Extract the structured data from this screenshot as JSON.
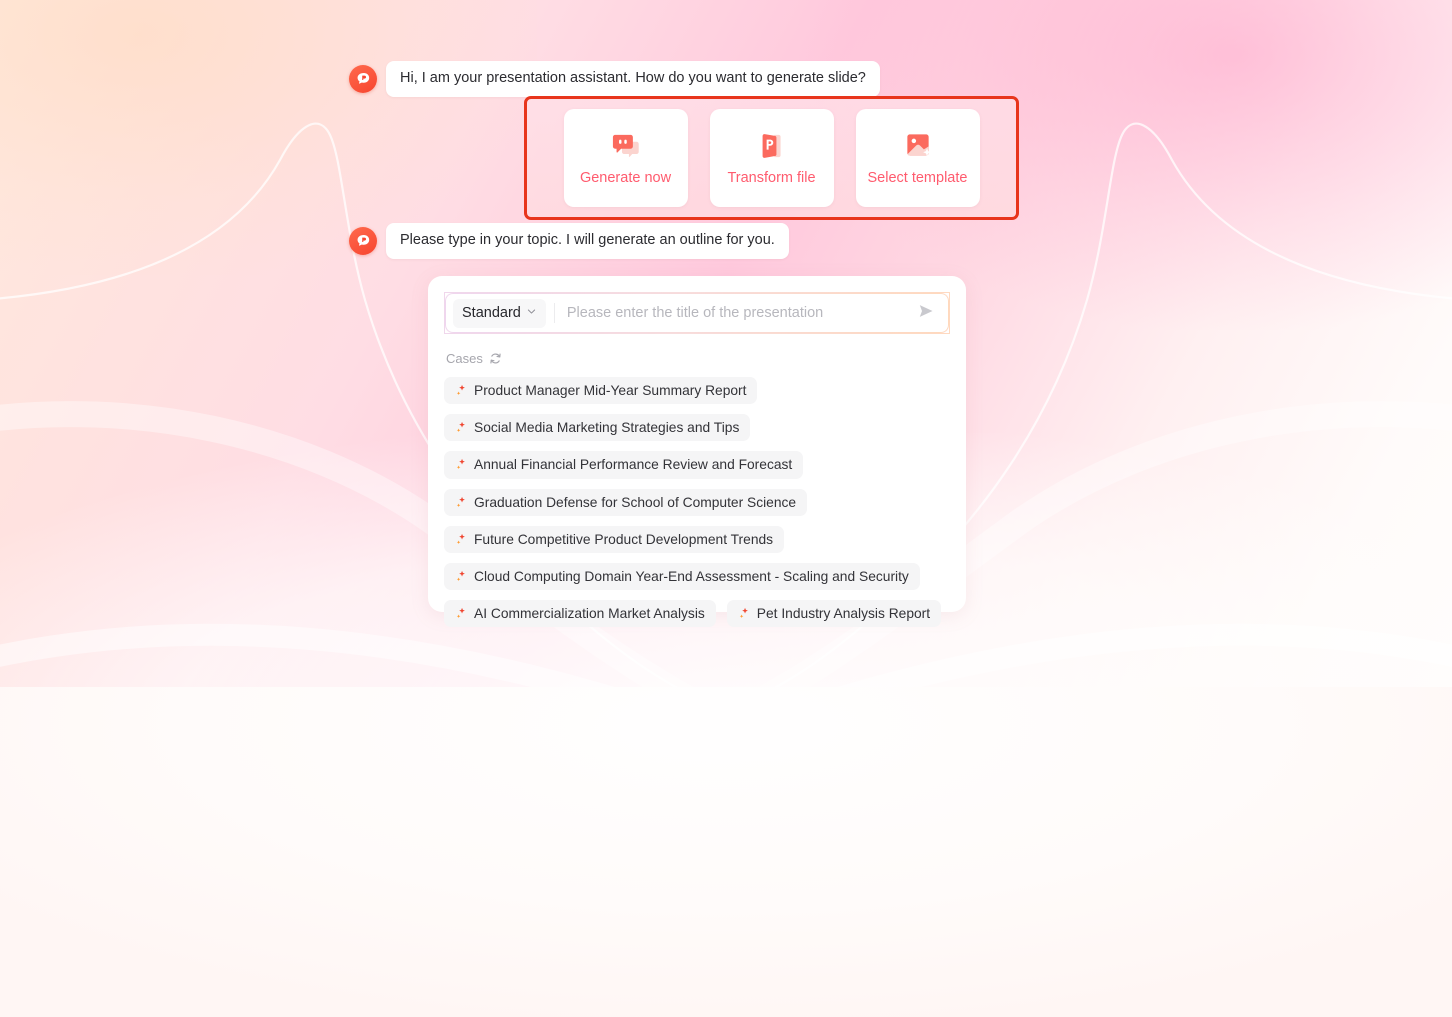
{
  "theme": {
    "accent": "#ff5b6e",
    "avatar_bg": "#f7452f",
    "highlight_border": "#e8351c",
    "panel_bg": "#ffffff",
    "chip_bg": "#f5f5f6",
    "background_gradient": [
      "#ffe9dd",
      "#ffc9dd",
      "#fffdfc"
    ]
  },
  "messages": [
    {
      "avatar_icon": "assistant-chat-bubble-icon",
      "text": "Hi, I am your presentation assistant. How do you want to generate slide?"
    },
    {
      "avatar_icon": "assistant-chat-bubble-icon",
      "text": "Please type in your topic. I will generate an outline for you."
    }
  ],
  "action_panel": {
    "cards": [
      {
        "label": "Generate now",
        "icon": "chat-bubble-icon"
      },
      {
        "label": "Transform file",
        "icon": "powerpoint-file-icon"
      },
      {
        "label": "Select template",
        "icon": "image-sparkle-icon"
      }
    ]
  },
  "composer": {
    "mode": {
      "label": "Standard",
      "chevron_icon": "chevron-down-icon"
    },
    "input": {
      "value": "",
      "placeholder": "Please enter the title of the presentation"
    },
    "send": {
      "icon": "send-arrow-icon"
    },
    "cases": {
      "label": "Cases",
      "refresh_icon": "refresh-icon",
      "items": [
        {
          "label": "Product Manager Mid-Year Summary Report",
          "icon": "sparkle-icon"
        },
        {
          "label": "Social Media Marketing Strategies and Tips",
          "icon": "sparkle-icon"
        },
        {
          "label": "Annual Financial Performance Review and Forecast",
          "icon": "sparkle-icon"
        },
        {
          "label": "Graduation Defense for School of Computer Science",
          "icon": "sparkle-icon"
        },
        {
          "label": "Future Competitive Product Development Trends",
          "icon": "sparkle-icon"
        },
        {
          "label": "Cloud Computing Domain Year-End Assessment - Scaling and Security",
          "icon": "sparkle-icon"
        },
        {
          "label": "AI Commercialization Market Analysis",
          "icon": "sparkle-icon"
        },
        {
          "label": "Pet Industry Analysis Report",
          "icon": "sparkle-icon"
        }
      ]
    }
  }
}
